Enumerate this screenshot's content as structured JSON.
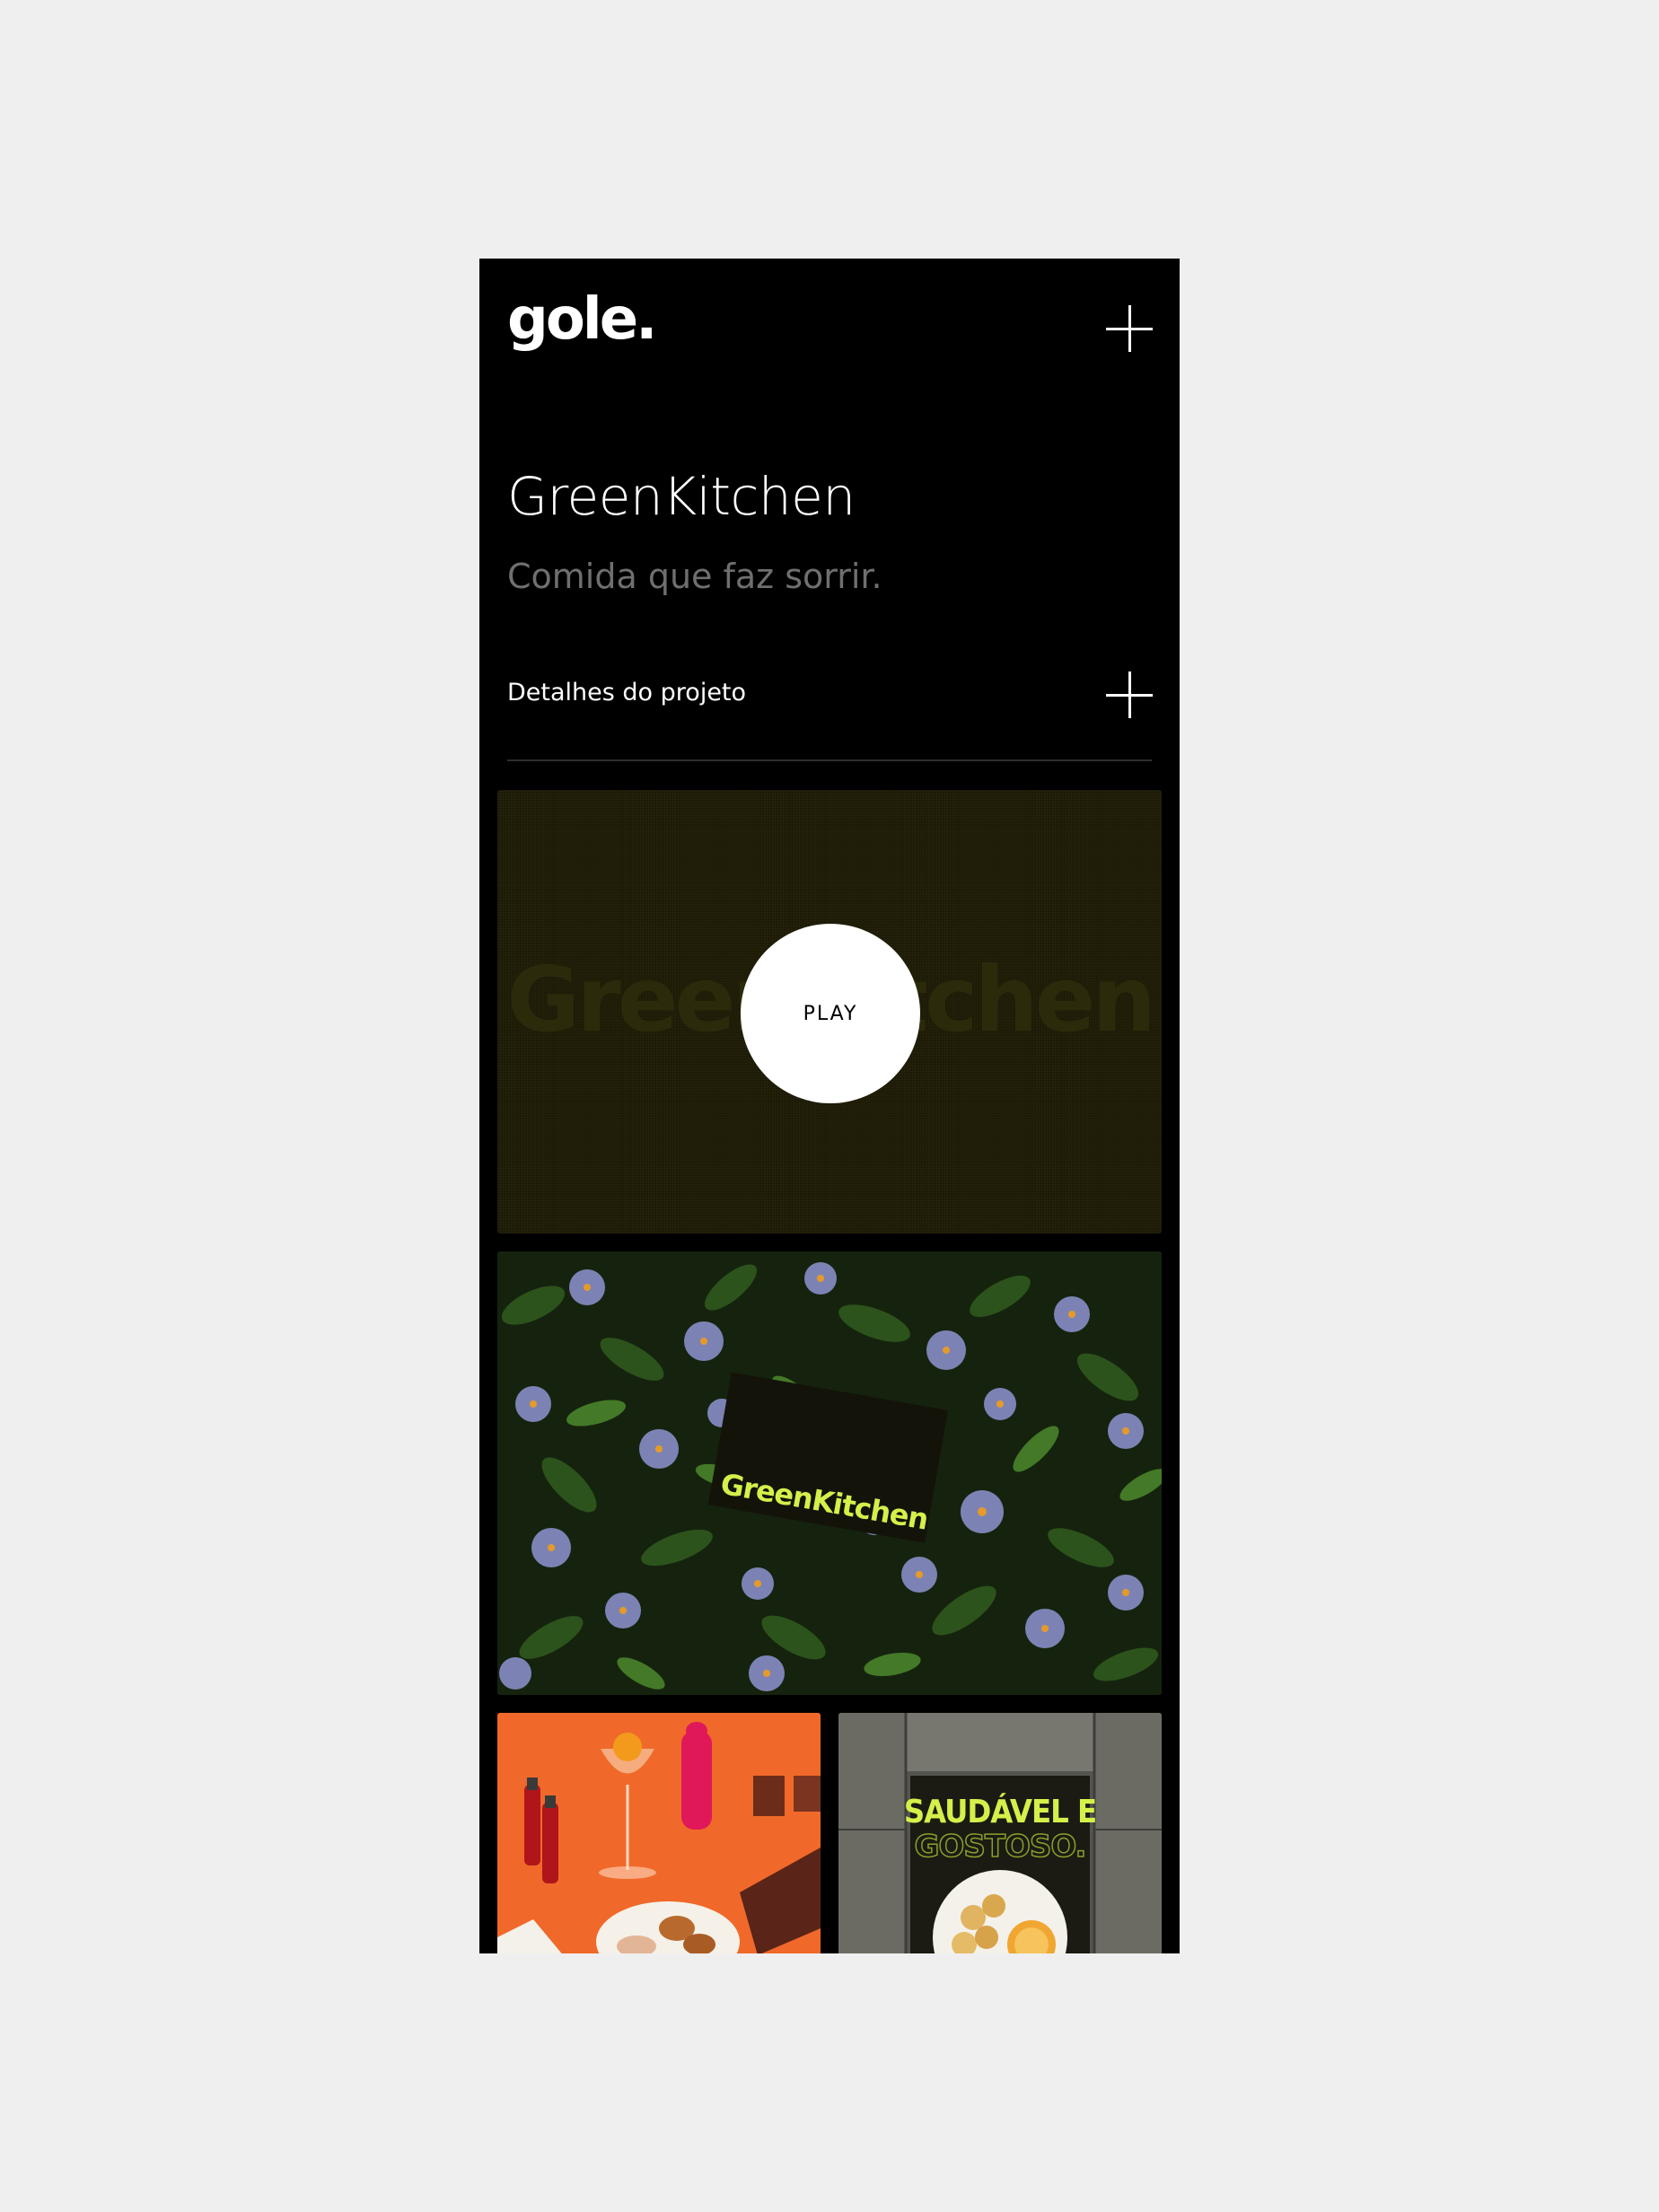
{
  "header": {
    "logo_text": "gole."
  },
  "project": {
    "title": "GreenKitchen",
    "subtitle": "Comida que faz sorrir.",
    "details_label": "Detalhes do projeto"
  },
  "video": {
    "watermark_text": "GreenKitchen",
    "play_label": "PLAY"
  },
  "gallery": {
    "card_brand_text": "GreenKitchen",
    "poster_line1": "SAUDÁVEL E",
    "poster_line2": "GOSTOSO."
  },
  "colors": {
    "background": "#000000",
    "page": "#efefef",
    "brand_lime": "#d4f04a",
    "muted_text": "#6f6f6f"
  },
  "icons": {
    "menu": "plus-icon",
    "details": "plus-icon"
  }
}
